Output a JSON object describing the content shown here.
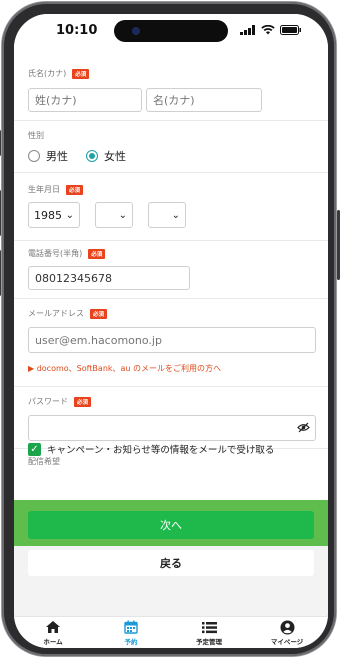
{
  "status": {
    "time": "10:10"
  },
  "form": {
    "kana_name": {
      "label": "氏名(カナ)",
      "required": "必須",
      "last_placeholder": "姓(カナ)",
      "first_placeholder": "名(カナ)"
    },
    "gender": {
      "label": "性別",
      "options": [
        "男性",
        "女性"
      ],
      "selected": "女性"
    },
    "birthdate": {
      "label": "生年月日",
      "required": "必須",
      "year": "1985",
      "month": "",
      "day": ""
    },
    "phone": {
      "label": "電話番号(半角)",
      "required": "必須",
      "value": "08012345678"
    },
    "email": {
      "label": "メールアドレス",
      "required": "必須",
      "placeholder": "user@em.hacomono.jp",
      "note": "▶ docomo、SoftBank、au のメールをご利用の方へ"
    },
    "password": {
      "label": "パスワード",
      "required": "必須",
      "value": ""
    },
    "newsletter": {
      "label": "配信希望",
      "checkbox_label": "キャンペーン・お知らせ等の情報をメールで受け取る",
      "checked": true
    },
    "next_label": "次へ",
    "back_label": "戻る"
  },
  "tabs": [
    {
      "label": "ホーム",
      "icon": "home-icon"
    },
    {
      "label": "予約",
      "icon": "calendar-icon",
      "active": true
    },
    {
      "label": "予定管理",
      "icon": "list-icon"
    },
    {
      "label": "マイページ",
      "icon": "user-icon"
    }
  ],
  "colors": {
    "accent": "#1ea2a6",
    "primary_button": "#1fb84b",
    "required_badge": "#e8431c",
    "active_tab": "#1a9ad6"
  }
}
